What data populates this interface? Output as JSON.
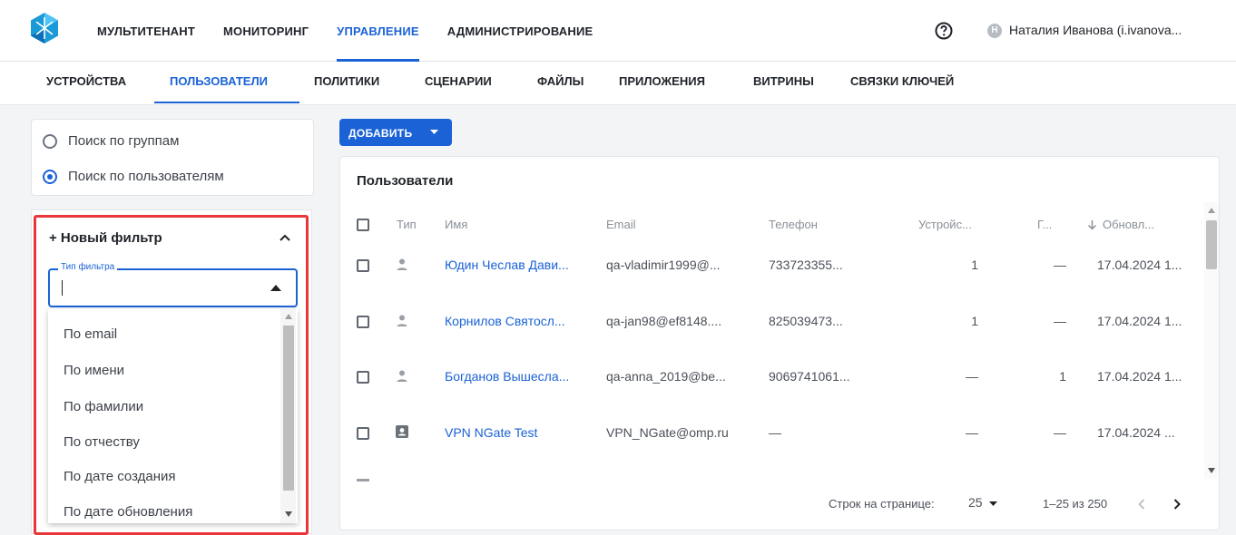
{
  "header": {
    "nav": [
      "МУЛЬТИТЕНАНТ",
      "МОНИТОРИНГ",
      "УПРАВЛЕНИЕ",
      "АДМИНИСТРИРОВАНИЕ"
    ],
    "active_nav": "УПРАВЛЕНИЕ",
    "user_initial": "Н",
    "user_name": "Наталия Иванова (i.ivanova..."
  },
  "subnav": {
    "items": [
      "УСТРОЙСТВА",
      "ПОЛЬЗОВАТЕЛИ",
      "ПОЛИТИКИ",
      "СЦЕНАРИИ",
      "ФАЙЛЫ",
      "ПРИЛОЖЕНИЯ",
      "ВИТРИНЫ",
      "СВЯЗКИ КЛЮЧЕЙ"
    ],
    "active": "ПОЛЬЗОВАТЕЛИ"
  },
  "search_mode": {
    "options": [
      "Поиск по группам",
      "Поиск по пользователям"
    ],
    "selected": "Поиск по пользователям"
  },
  "filter": {
    "title": "+ Новый фильтр",
    "field_label": "Тип фильтра",
    "value": "",
    "options": [
      "По email",
      "По имени",
      "По фамилии",
      "По отчеству",
      "По дате создания",
      "По дате обновления"
    ]
  },
  "add_button": {
    "label": "ДОБАВИТЬ"
  },
  "users_table": {
    "title": "Пользователи",
    "columns": [
      "Тип",
      "Имя",
      "Email",
      "Телефон",
      "Устройс...",
      "Г...",
      "Обновл..."
    ],
    "rows": [
      {
        "type_icon": "person-icon",
        "name": "Юдин Чеслав Дави...",
        "email": "qa-vladimir1999@...",
        "phone": "733723355...",
        "devices": "1",
        "groups": "—",
        "updated": "17.04.2024 1..."
      },
      {
        "type_icon": "person-icon",
        "name": "Корнилов Святосл...",
        "email": "qa-jan98@ef8148....",
        "phone": "825039473...",
        "devices": "1",
        "groups": "—",
        "updated": "17.04.2024 1..."
      },
      {
        "type_icon": "person-icon",
        "name": "Богданов Вышесла...",
        "email": "qa-anna_2019@be...",
        "phone": "9069741061...",
        "devices": "—",
        "groups": "1",
        "updated": "17.04.2024 1..."
      },
      {
        "type_icon": "service-account-icon",
        "name": "VPN NGate Test",
        "email": "VPN_NGate@omp.ru",
        "phone": "—",
        "devices": "—",
        "groups": "—",
        "updated": "17.04.2024 ..."
      }
    ],
    "footer": {
      "rows_per_page_label": "Строк на странице:",
      "rows_per_page": "25",
      "range": "1–25 из 250"
    }
  },
  "colors": {
    "accent": "#1a62d6",
    "highlight": "#e9363b"
  }
}
